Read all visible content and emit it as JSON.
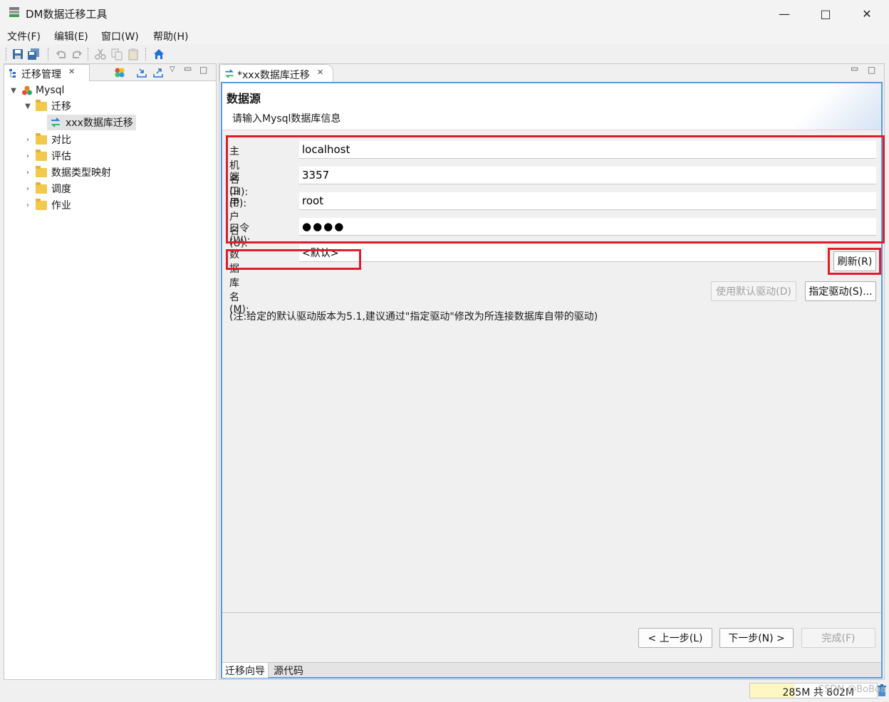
{
  "window": {
    "title": "DM数据迁移工具",
    "minimize": "—",
    "maximize": "□",
    "close": "✕"
  },
  "menu": [
    "文件(F)",
    "编辑(E)",
    "窗口(W)",
    "帮助(H)"
  ],
  "left_panel": {
    "tab_label": "迁移管理",
    "tab_close": "✕",
    "tree": {
      "root": "Mysql",
      "migration_folder": "迁移",
      "migration_item": "xxx数据库迁移",
      "folders": [
        "对比",
        "评估",
        "数据类型映射",
        "调度",
        "作业"
      ]
    }
  },
  "editor": {
    "tab_label": "*xxx数据库迁移",
    "tab_close": "✕",
    "wizard_title": "数据源",
    "wizard_desc": "请输入Mysql数据库信息",
    "fields": {
      "host": {
        "label": "主机名(H):",
        "value": "localhost"
      },
      "port": {
        "label": "端口(P):",
        "value": "3357"
      },
      "user": {
        "label": "用户名(U):",
        "value": "root"
      },
      "password": {
        "label": "口令(W):",
        "value": "●●●●"
      },
      "database": {
        "label": "数据库名(M):",
        "value": "<默认>"
      }
    },
    "refresh_button": "刷新(R)",
    "default_driver_button": "使用默认驱动(D)",
    "specify_driver_button": "指定驱动(S)...",
    "note": "(注:给定的默认驱动版本为5.1,建议通过\"指定驱动\"修改为所连接数据库自带的驱动)",
    "prev_button": "< 上一步(L)",
    "next_button": "下一步(N) >",
    "finish_button": "完成(F)",
    "bottom_tabs": [
      "迁移向导",
      "源代码"
    ]
  },
  "status": {
    "heap_text": "285M 共 802M",
    "heap_fraction": 0.355,
    "watermark": "CSDN @BoBoa"
  },
  "colors": {
    "highlight_box": "#e01c2b",
    "accent": "#1e6fd9",
    "folder": "#f2c94c"
  }
}
